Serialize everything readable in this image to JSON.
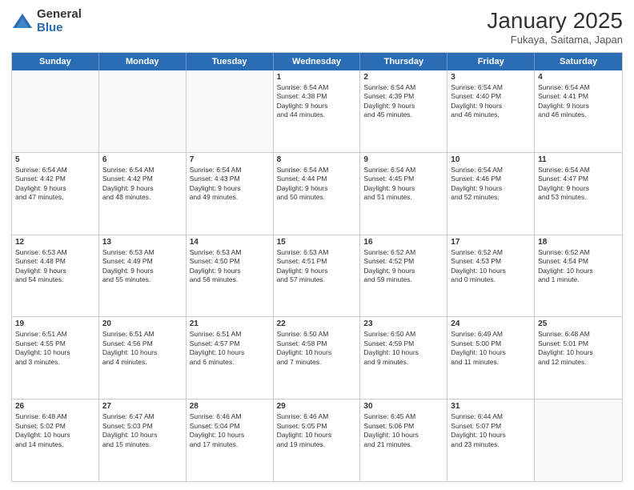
{
  "logo": {
    "general": "General",
    "blue": "Blue"
  },
  "header": {
    "month": "January 2025",
    "location": "Fukaya, Saitama, Japan"
  },
  "weekdays": [
    "Sunday",
    "Monday",
    "Tuesday",
    "Wednesday",
    "Thursday",
    "Friday",
    "Saturday"
  ],
  "weeks": [
    [
      {
        "day": "",
        "lines": []
      },
      {
        "day": "",
        "lines": []
      },
      {
        "day": "",
        "lines": []
      },
      {
        "day": "1",
        "lines": [
          "Sunrise: 6:54 AM",
          "Sunset: 4:38 PM",
          "Daylight: 9 hours",
          "and 44 minutes."
        ]
      },
      {
        "day": "2",
        "lines": [
          "Sunrise: 6:54 AM",
          "Sunset: 4:39 PM",
          "Daylight: 9 hours",
          "and 45 minutes."
        ]
      },
      {
        "day": "3",
        "lines": [
          "Sunrise: 6:54 AM",
          "Sunset: 4:40 PM",
          "Daylight: 9 hours",
          "and 46 minutes."
        ]
      },
      {
        "day": "4",
        "lines": [
          "Sunrise: 6:54 AM",
          "Sunset: 4:41 PM",
          "Daylight: 9 hours",
          "and 46 minutes."
        ]
      }
    ],
    [
      {
        "day": "5",
        "lines": [
          "Sunrise: 6:54 AM",
          "Sunset: 4:42 PM",
          "Daylight: 9 hours",
          "and 47 minutes."
        ]
      },
      {
        "day": "6",
        "lines": [
          "Sunrise: 6:54 AM",
          "Sunset: 4:42 PM",
          "Daylight: 9 hours",
          "and 48 minutes."
        ]
      },
      {
        "day": "7",
        "lines": [
          "Sunrise: 6:54 AM",
          "Sunset: 4:43 PM",
          "Daylight: 9 hours",
          "and 49 minutes."
        ]
      },
      {
        "day": "8",
        "lines": [
          "Sunrise: 6:54 AM",
          "Sunset: 4:44 PM",
          "Daylight: 9 hours",
          "and 50 minutes."
        ]
      },
      {
        "day": "9",
        "lines": [
          "Sunrise: 6:54 AM",
          "Sunset: 4:45 PM",
          "Daylight: 9 hours",
          "and 51 minutes."
        ]
      },
      {
        "day": "10",
        "lines": [
          "Sunrise: 6:54 AM",
          "Sunset: 4:46 PM",
          "Daylight: 9 hours",
          "and 52 minutes."
        ]
      },
      {
        "day": "11",
        "lines": [
          "Sunrise: 6:54 AM",
          "Sunset: 4:47 PM",
          "Daylight: 9 hours",
          "and 53 minutes."
        ]
      }
    ],
    [
      {
        "day": "12",
        "lines": [
          "Sunrise: 6:53 AM",
          "Sunset: 4:48 PM",
          "Daylight: 9 hours",
          "and 54 minutes."
        ]
      },
      {
        "day": "13",
        "lines": [
          "Sunrise: 6:53 AM",
          "Sunset: 4:49 PM",
          "Daylight: 9 hours",
          "and 55 minutes."
        ]
      },
      {
        "day": "14",
        "lines": [
          "Sunrise: 6:53 AM",
          "Sunset: 4:50 PM",
          "Daylight: 9 hours",
          "and 56 minutes."
        ]
      },
      {
        "day": "15",
        "lines": [
          "Sunrise: 6:53 AM",
          "Sunset: 4:51 PM",
          "Daylight: 9 hours",
          "and 57 minutes."
        ]
      },
      {
        "day": "16",
        "lines": [
          "Sunrise: 6:52 AM",
          "Sunset: 4:52 PM",
          "Daylight: 9 hours",
          "and 59 minutes."
        ]
      },
      {
        "day": "17",
        "lines": [
          "Sunrise: 6:52 AM",
          "Sunset: 4:53 PM",
          "Daylight: 10 hours",
          "and 0 minutes."
        ]
      },
      {
        "day": "18",
        "lines": [
          "Sunrise: 6:52 AM",
          "Sunset: 4:54 PM",
          "Daylight: 10 hours",
          "and 1 minute."
        ]
      }
    ],
    [
      {
        "day": "19",
        "lines": [
          "Sunrise: 6:51 AM",
          "Sunset: 4:55 PM",
          "Daylight: 10 hours",
          "and 3 minutes."
        ]
      },
      {
        "day": "20",
        "lines": [
          "Sunrise: 6:51 AM",
          "Sunset: 4:56 PM",
          "Daylight: 10 hours",
          "and 4 minutes."
        ]
      },
      {
        "day": "21",
        "lines": [
          "Sunrise: 6:51 AM",
          "Sunset: 4:57 PM",
          "Daylight: 10 hours",
          "and 6 minutes."
        ]
      },
      {
        "day": "22",
        "lines": [
          "Sunrise: 6:50 AM",
          "Sunset: 4:58 PM",
          "Daylight: 10 hours",
          "and 7 minutes."
        ]
      },
      {
        "day": "23",
        "lines": [
          "Sunrise: 6:50 AM",
          "Sunset: 4:59 PM",
          "Daylight: 10 hours",
          "and 9 minutes."
        ]
      },
      {
        "day": "24",
        "lines": [
          "Sunrise: 6:49 AM",
          "Sunset: 5:00 PM",
          "Daylight: 10 hours",
          "and 11 minutes."
        ]
      },
      {
        "day": "25",
        "lines": [
          "Sunrise: 6:48 AM",
          "Sunset: 5:01 PM",
          "Daylight: 10 hours",
          "and 12 minutes."
        ]
      }
    ],
    [
      {
        "day": "26",
        "lines": [
          "Sunrise: 6:48 AM",
          "Sunset: 5:02 PM",
          "Daylight: 10 hours",
          "and 14 minutes."
        ]
      },
      {
        "day": "27",
        "lines": [
          "Sunrise: 6:47 AM",
          "Sunset: 5:03 PM",
          "Daylight: 10 hours",
          "and 15 minutes."
        ]
      },
      {
        "day": "28",
        "lines": [
          "Sunrise: 6:46 AM",
          "Sunset: 5:04 PM",
          "Daylight: 10 hours",
          "and 17 minutes."
        ]
      },
      {
        "day": "29",
        "lines": [
          "Sunrise: 6:46 AM",
          "Sunset: 5:05 PM",
          "Daylight: 10 hours",
          "and 19 minutes."
        ]
      },
      {
        "day": "30",
        "lines": [
          "Sunrise: 6:45 AM",
          "Sunset: 5:06 PM",
          "Daylight: 10 hours",
          "and 21 minutes."
        ]
      },
      {
        "day": "31",
        "lines": [
          "Sunrise: 6:44 AM",
          "Sunset: 5:07 PM",
          "Daylight: 10 hours",
          "and 23 minutes."
        ]
      },
      {
        "day": "",
        "lines": []
      }
    ]
  ]
}
